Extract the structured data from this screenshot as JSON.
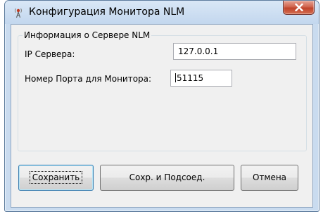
{
  "window": {
    "title": "Конфигурация Монитора NLM",
    "icons": {
      "app": "antenna-icon",
      "close": "close-icon"
    }
  },
  "group": {
    "legend": "Информация о Сервере NLM",
    "ip_label": "IP Сервера:",
    "ip_value": "127.0.0.1",
    "port_label": "Номер Порта для Монитора:",
    "port_value": "51115"
  },
  "buttons": {
    "save": "Сохранить",
    "save_connect": "Сохр. и Подсоед.",
    "cancel": "Отмена"
  },
  "colors": {
    "close_button": "#c9452c",
    "frame": "#c9dbef",
    "client_bg": "#f0f0f0"
  }
}
